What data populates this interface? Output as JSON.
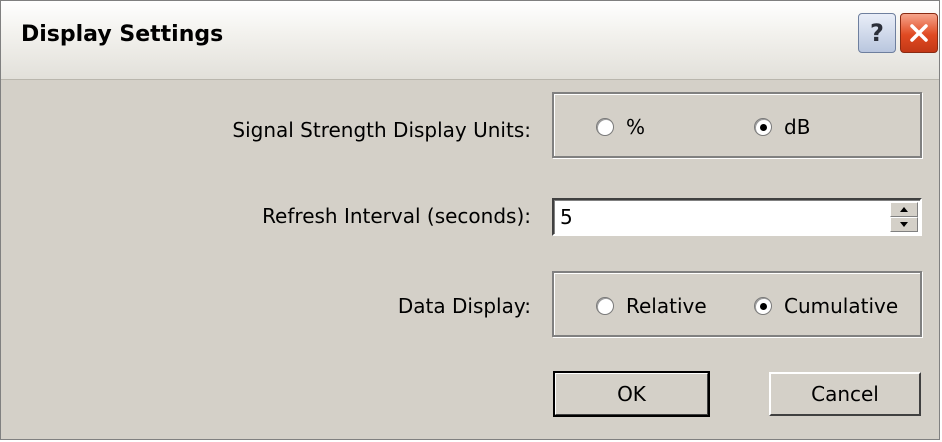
{
  "window": {
    "title": "Display Settings",
    "help_glyph": "?",
    "help_icon": "help-question-icon",
    "close_icon": "close-x-icon"
  },
  "signal_units": {
    "label": "Signal Strength Display Units:",
    "options": [
      {
        "label": "%",
        "checked": false
      },
      {
        "label": "dB",
        "checked": true
      }
    ]
  },
  "refresh": {
    "label": "Refresh Interval (seconds):",
    "value": "5"
  },
  "data_display": {
    "label": "Data Display:",
    "options": [
      {
        "label": "Relative",
        "checked": false
      },
      {
        "label": "Cumulative",
        "checked": true
      }
    ]
  },
  "buttons": {
    "ok": "OK",
    "cancel": "Cancel"
  },
  "colors": {
    "dialog_face": "#d4d0c8",
    "close_button": "#e04a22",
    "help_button": "#b9c6de"
  }
}
